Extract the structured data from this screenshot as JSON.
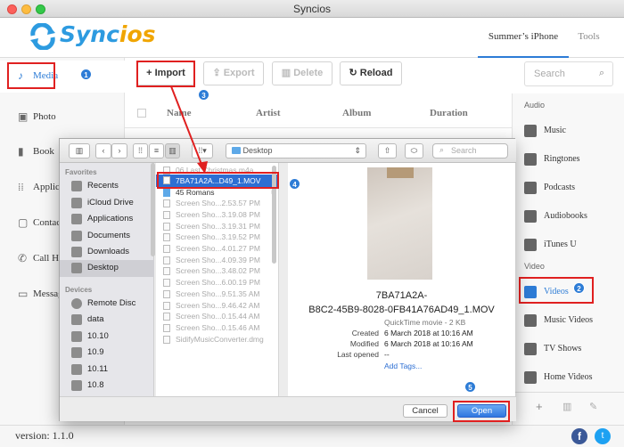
{
  "window": {
    "title": "Syncios"
  },
  "brand": {
    "name_a": "Sync",
    "name_b": "ios"
  },
  "header": {
    "device_tab": "Summer’s iPhone",
    "tools_tab": "Tools"
  },
  "sidebar": {
    "items": [
      {
        "label": "Media",
        "icon": "music-note-icon"
      },
      {
        "label": "Photo",
        "icon": "photo-icon"
      },
      {
        "label": "Book",
        "icon": "book-icon"
      },
      {
        "label": "Applica",
        "icon": "apps-icon"
      },
      {
        "label": "Contac",
        "icon": "contacts-icon"
      },
      {
        "label": "Call Hi",
        "icon": "phone-icon"
      },
      {
        "label": "Messag",
        "icon": "message-icon"
      }
    ]
  },
  "toolbar": {
    "import": "Import",
    "export": "Export",
    "delete": "Delete",
    "reload": "Reload",
    "search_placeholder": "Search"
  },
  "table": {
    "columns": [
      "Name",
      "Artist",
      "Album",
      "Duration"
    ]
  },
  "right_panel": {
    "audio_header": "Audio",
    "audio_items": [
      "Music",
      "Ringtones",
      "Podcasts",
      "Audiobooks",
      "iTunes U"
    ],
    "video_header": "Video",
    "video_items": [
      "Videos",
      "Music Videos",
      "TV Shows",
      "Home Videos"
    ]
  },
  "footer": {
    "version": "version: 1.1.0"
  },
  "badges": [
    "1",
    "2",
    "3",
    "4",
    "5"
  ],
  "dialog": {
    "location": "Desktop",
    "search_placeholder": "Search",
    "favorites_header": "Favorites",
    "favorites": [
      "Recents",
      "iCloud Drive",
      "Applications",
      "Documents",
      "Downloads",
      "Desktop"
    ],
    "devices_header": "Devices",
    "devices": [
      "Remote Disc",
      "data",
      "10.10",
      "10.9",
      "10.11",
      "10.8"
    ],
    "files": [
      "06 Last Christmas.m4a",
      "7BA71A2A...D49_1.MOV",
      "45 Romans",
      "Screen Sho...2.53.57 PM",
      "Screen Sho...3.19.08 PM",
      "Screen Sho...3.19.31 PM",
      "Screen Sho...3.19.52 PM",
      "Screen Sho...4.01.27 PM",
      "Screen Sho...4.09.39 PM",
      "Screen Sho...3.48.02 PM",
      "Screen Sho...6.00.19 PM",
      "Screen Sho...9.51.35 AM",
      "Screen Sho...9.46.42 AM",
      "Screen Sho...0.15.44 AM",
      "Screen Sho...0.15.46 AM",
      "SidifyMusicConverter.dmg"
    ],
    "preview": {
      "name_line1": "7BA71A2A-",
      "name_line2": "B8C2-45B9-8028-0FB41A76AD49_1.MOV",
      "kind": "QuickTime movie - 2 KB",
      "created_label": "Created",
      "created": "6 March 2018 at 10:16 AM",
      "modified_label": "Modified",
      "modified": "6 March 2018 at 10:16 AM",
      "last_opened_label": "Last opened",
      "last_opened": "--",
      "add_tags": "Add Tags..."
    },
    "cancel": "Cancel",
    "open": "Open"
  },
  "colors": {
    "accent": "#2d7cd6",
    "highlight_box": "#e02020",
    "brand_blue": "#2d9be0",
    "brand_orange": "#f0a500"
  }
}
